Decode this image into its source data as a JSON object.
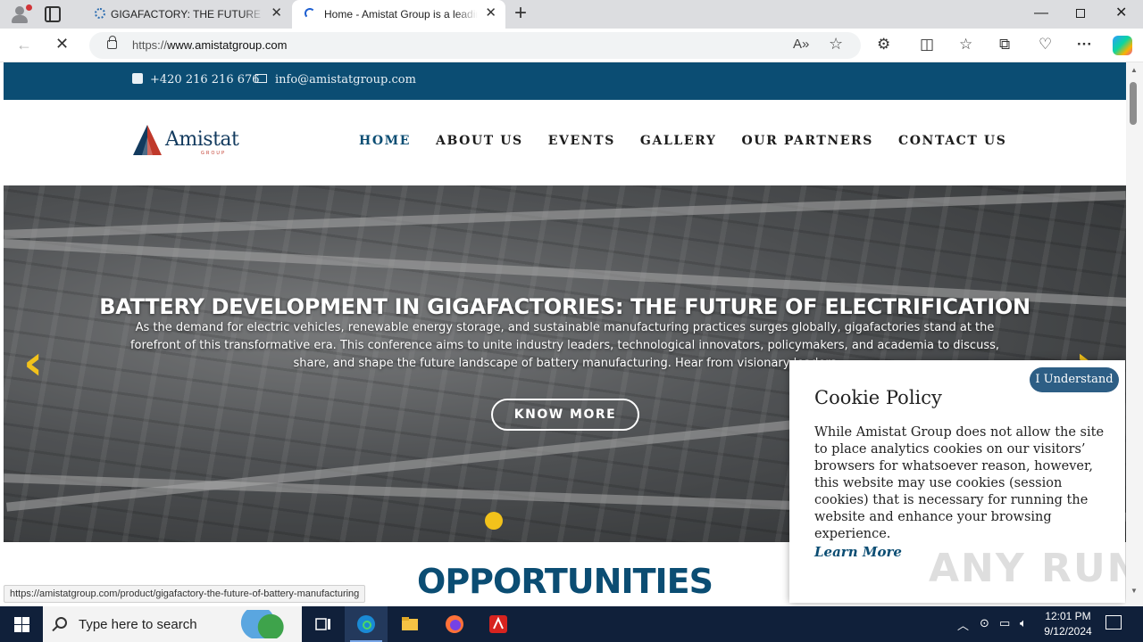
{
  "browser": {
    "tabs": [
      {
        "title": "GIGAFACTORY: THE FUTURE OF BATTERY MANUFACTURING",
        "close": "✕"
      },
      {
        "title": "Home - Amistat Group is a leading",
        "close": "✕"
      }
    ],
    "new_tab": "+",
    "window_controls": {
      "minimize": "—",
      "close": "✕"
    },
    "address": {
      "prefix": "https://",
      "host": "www.amistatgroup.com"
    },
    "nav_icons": {
      "back": "←",
      "stop": "✕",
      "read_aloud": "A»",
      "favorite": "☆",
      "extensions": "⚙",
      "split": "◫",
      "favorites": "☆",
      "collections": "⧉",
      "performance": "♡",
      "menu": "···"
    }
  },
  "site": {
    "topbar": {
      "phone": "+420 216 216 676",
      "email": "info@amistatgroup.com"
    },
    "logo": {
      "word": "Amistat",
      "sub": "GROUP"
    },
    "nav": [
      "HOME",
      "ABOUT US",
      "EVENTS",
      "GALLERY",
      "OUR PARTNERS",
      "CONTACT US"
    ],
    "hero": {
      "title": "BATTERY DEVELOPMENT IN GIGAFACTORIES: THE FUTURE OF ELECTRIFICATION",
      "text": "As the demand for electric vehicles, renewable energy storage, and sustainable manufacturing practices surges globally, gigafactories stand at the forefront of this transformative era. This conference aims to unite industry leaders, technological innovators, policymakers, and academia to discuss, share, and shape the future landscape of battery manufacturing. Hear from visionary leaders",
      "button": "KNOW MORE",
      "prev": "‹",
      "next": "›"
    },
    "section_title": "OPPORTUNITIES",
    "status_url": "https://amistatgroup.com/product/gigafactory-the-future-of-battery-manufacturing",
    "cookie": {
      "title": "Cookie Policy",
      "text": "While Amistat Group does not allow the site to place analytics cookies on our visitors’ browsers for whatsoever reason, however, this website may use cookies (session cookies) that is necessary for running the website and enhance your browsing experience.",
      "learn_more": "Learn More",
      "accept": "I Understand"
    },
    "watermark": "ANY RUN"
  },
  "taskbar": {
    "search_placeholder": "Type here to search",
    "time": "12:01 PM",
    "date": "9/12/2024"
  },
  "colors": {
    "brand_blue": "#0b4d73",
    "accent_yellow": "#f2c21b",
    "cookie_button": "#2d5e85"
  }
}
